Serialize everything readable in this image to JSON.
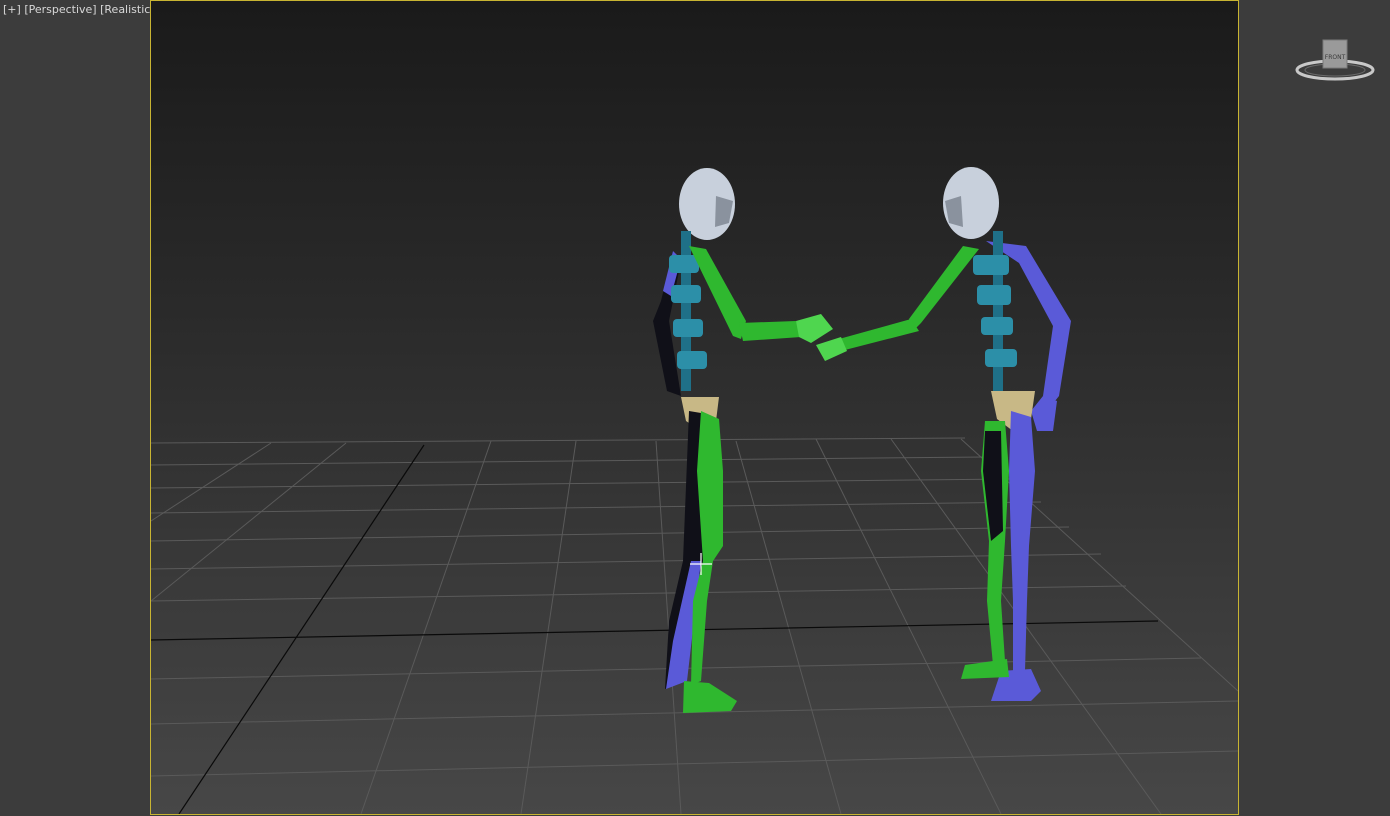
{
  "viewport": {
    "label_plus": "[+]",
    "label_view": "[Perspective]",
    "label_shading": "[Realistic]"
  },
  "viewcube": {
    "face_label": "FRONT"
  },
  "colors": {
    "viewport_border": "#c8b432",
    "bone_green": "#2fb82f",
    "bone_blue": "#5a5ad8",
    "bone_teal": "#2c8fa8",
    "pelvis": "#c8b886",
    "head": "#c8d0dc"
  },
  "icons": {
    "cursor": "move-cursor-icon",
    "viewcube": "viewcube-icon"
  }
}
